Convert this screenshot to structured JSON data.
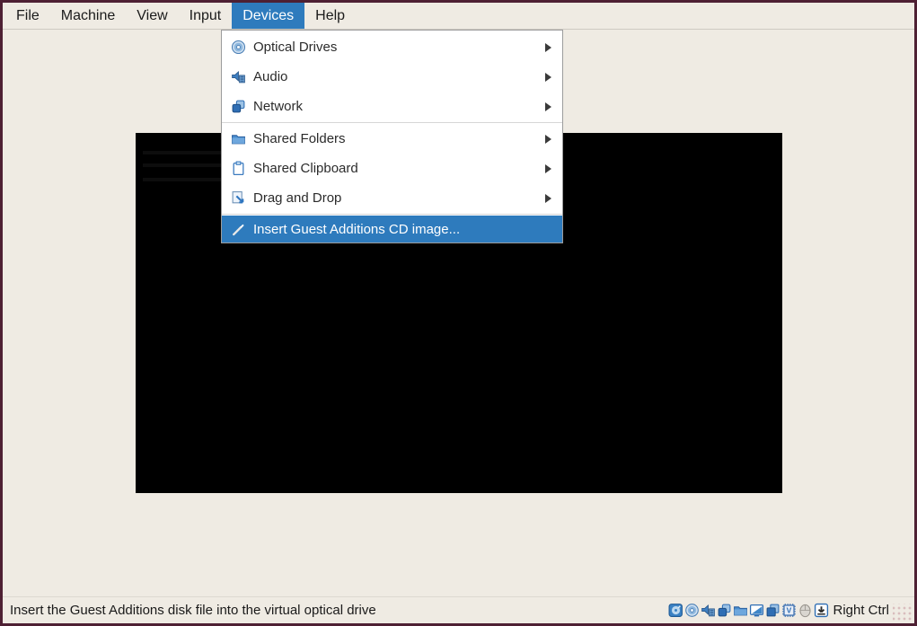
{
  "window": {
    "border_color": "#4e2033",
    "background_color": "#efebe3",
    "highlight_color": "#2e7bbd",
    "app": "VirtualBox virtual machine window"
  },
  "menubar": {
    "items": [
      {
        "label": "File",
        "active": false
      },
      {
        "label": "Machine",
        "active": false
      },
      {
        "label": "View",
        "active": false
      },
      {
        "label": "Input",
        "active": false
      },
      {
        "label": "Devices",
        "active": true
      },
      {
        "label": "Help",
        "active": false
      }
    ]
  },
  "devices_menu": {
    "items": [
      {
        "label": "Optical Drives",
        "icon": "optical-drives-icon",
        "has_submenu": true,
        "highlighted": false
      },
      {
        "label": "Audio",
        "icon": "audio-icon",
        "has_submenu": true,
        "highlighted": false
      },
      {
        "label": "Network",
        "icon": "network-icon",
        "has_submenu": true,
        "highlighted": false
      },
      {
        "label": "Shared Folders",
        "icon": "shared-folders-icon",
        "has_submenu": true,
        "highlighted": false
      },
      {
        "label": "Shared Clipboard",
        "icon": "shared-clipboard-icon",
        "has_submenu": true,
        "highlighted": false
      },
      {
        "label": "Drag and Drop",
        "icon": "drag-and-drop-icon",
        "has_submenu": true,
        "highlighted": false
      },
      {
        "label": "Insert Guest Additions CD image...",
        "icon": "insert-guest-additions-icon",
        "has_submenu": false,
        "highlighted": true
      }
    ]
  },
  "statusbar": {
    "message": "Insert the Guest Additions disk file into the virtual optical drive",
    "host_key": "Right Ctrl",
    "icons": [
      "hard-disk-icon",
      "optical-drive-icon",
      "audio-icon",
      "network-icon",
      "shared-folders-icon",
      "display-icon",
      "recording-icon",
      "features-chip-icon",
      "mouse-icon",
      "keyboard-icon"
    ]
  }
}
